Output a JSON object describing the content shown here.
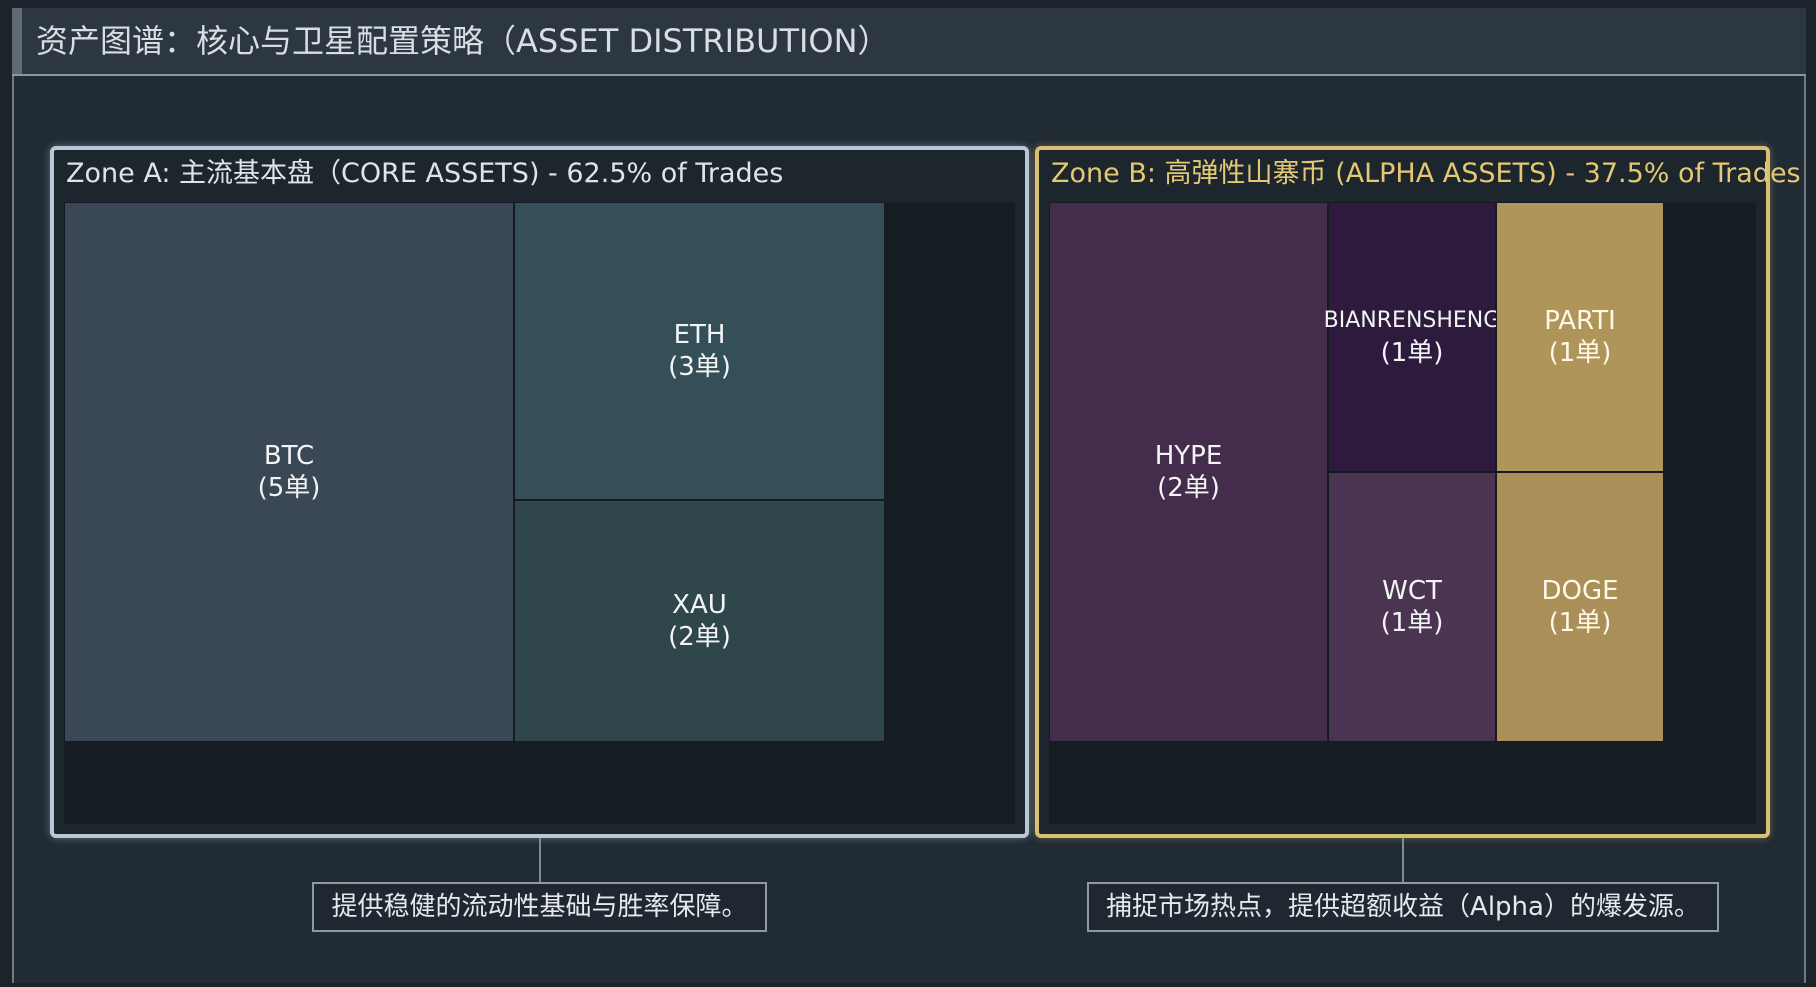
{
  "header": {
    "title": "资产图谱：核心与卫星配置策略（ASSET DISTRIBUTION）"
  },
  "zones": [
    {
      "label": "Zone A: 主流基本盘（CORE ASSETS) - 62.5% of Trades",
      "accent_color": "#b9c8d4",
      "note": "提供稳健的流动性基础与胜率保障。"
    },
    {
      "label": "Zone B: 高弹性山寨币 (ALPHA ASSETS) - 37.5% of Trades",
      "accent_color": "#d7bf73",
      "note": "捕捉市场热点，提供超额收益（Alpha）的爆发源。"
    }
  ],
  "chart_data": {
    "type": "treemap",
    "title": "资产图谱：核心与卫星配置策略（ASSET DISTRIBUTION）",
    "groups": [
      {
        "name": "Zone A: 主流基本盘（CORE ASSETS) - 62.5% of Trades",
        "share_percent": 62.5,
        "items": [
          {
            "name": "BTC",
            "count_label": "(5单)",
            "value": 5,
            "color": "#3a4754"
          },
          {
            "name": "ETH",
            "count_label": "(3单)",
            "value": 3,
            "color": "#354f58"
          },
          {
            "name": "XAU",
            "count_label": "(2单)",
            "value": 2,
            "color": "#2f464b"
          }
        ]
      },
      {
        "name": "Zone B: 高弹性山寨币 (ALPHA ASSETS) - 37.5% of Trades",
        "share_percent": 37.5,
        "items": [
          {
            "name": "HYPE",
            "count_label": "(2单)",
            "value": 2,
            "color": "#442c4c"
          },
          {
            "name": "BIANRENSHENG",
            "count_label": "(1单)",
            "value": 1,
            "color": "#2d1a3c"
          },
          {
            "name": "PARTI",
            "count_label": "(1单)",
            "value": 1,
            "color": "#b0955a"
          },
          {
            "name": "WCT",
            "count_label": "(1单)",
            "value": 1,
            "color": "#4a3451"
          },
          {
            "name": "DOGE",
            "count_label": "(1单)",
            "value": 1,
            "color": "#aa9058"
          }
        ]
      }
    ]
  }
}
